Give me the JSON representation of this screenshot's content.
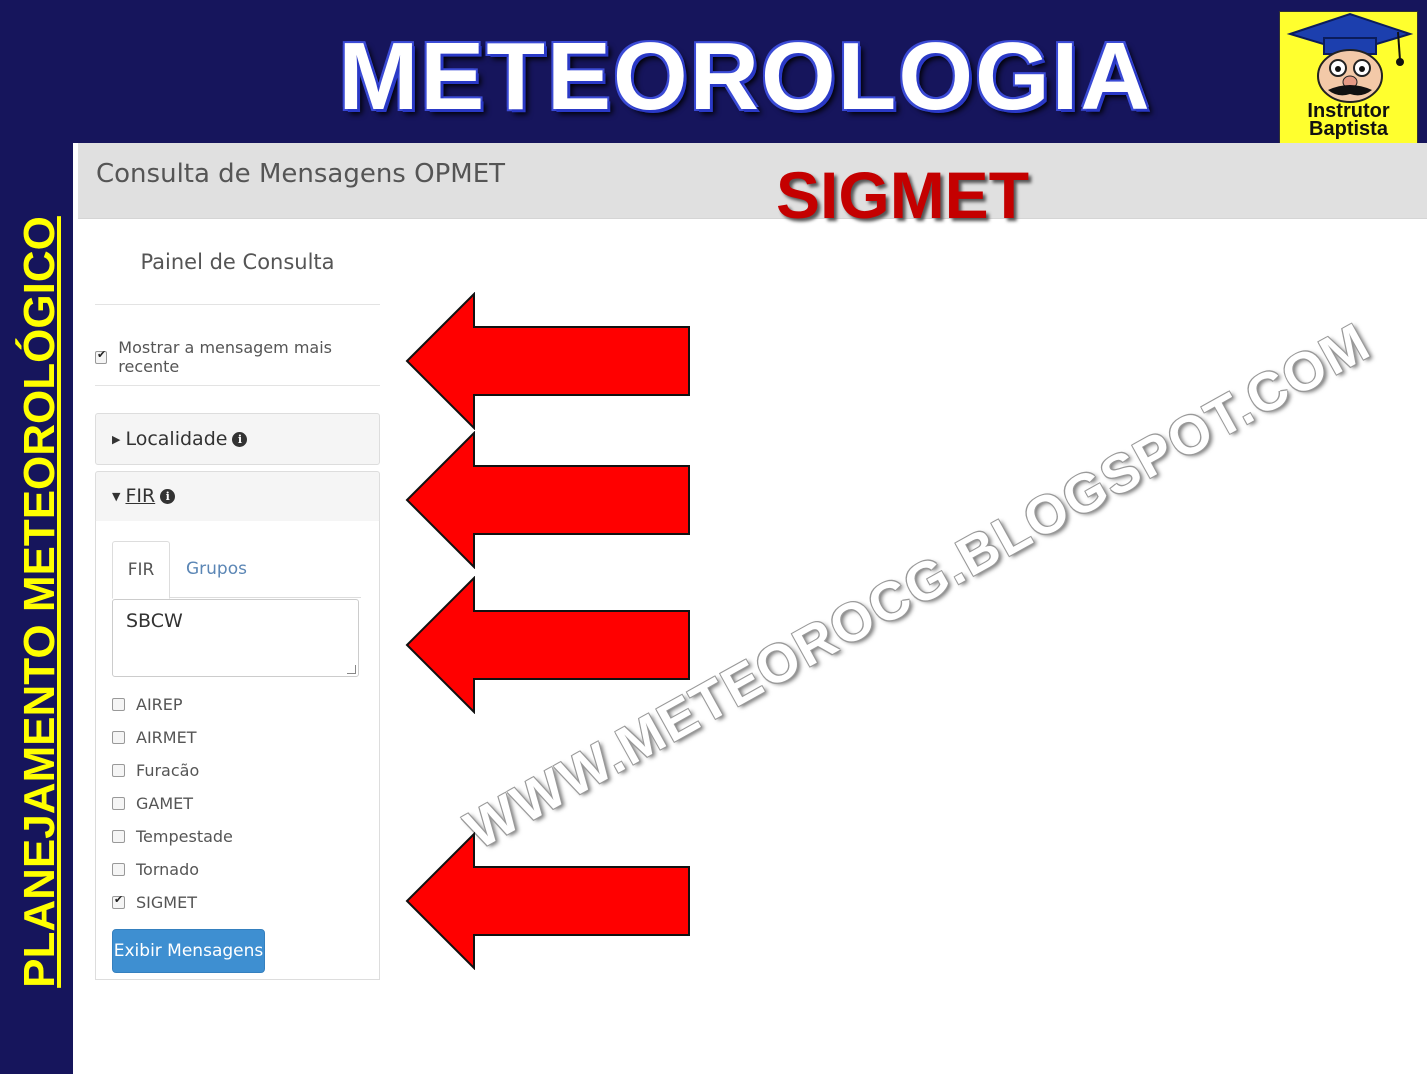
{
  "slide": {
    "title": "METEOROLOGIA",
    "side_title": "PLANEJAMENTO METEOROLÓGICO",
    "logo_text_line1": "Instrutor",
    "logo_text_line2": "Baptista",
    "overlay_title": "SIGMET",
    "watermark": "WWW.METEOROCG.BLOGSPOT.COM"
  },
  "app": {
    "header_title": "Consulta de Mensagens OPMET",
    "panel_title": "Painel de Consulta",
    "recent_checkbox": {
      "label": "Mostrar a mensagem mais recente",
      "checked": true
    },
    "accordion": {
      "localidade_label": "Localidade",
      "fir_label": "FIR"
    },
    "tabs": {
      "fir": "FIR",
      "grupos": "Grupos"
    },
    "fir_input_value": "SBCW",
    "message_types": [
      {
        "label": "AIREP",
        "checked": false
      },
      {
        "label": "AIRMET",
        "checked": false
      },
      {
        "label": "Furacão",
        "checked": false
      },
      {
        "label": "GAMET",
        "checked": false
      },
      {
        "label": "Tempestade",
        "checked": false
      },
      {
        "label": "Tornado",
        "checked": false
      },
      {
        "label": "SIGMET",
        "checked": true
      }
    ],
    "submit_label": "Exibir Mensagens"
  },
  "colors": {
    "slide_background": "#16155c",
    "title_yellow": "#ffff00",
    "sigmet_red": "#c40000",
    "arrow_red": "#ff0000",
    "button_blue": "#3e8fd1"
  }
}
